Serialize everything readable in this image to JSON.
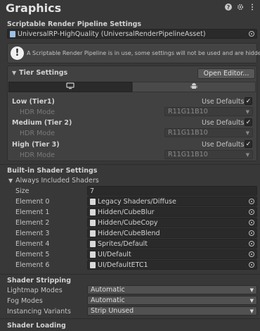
{
  "title": "Graphics",
  "header_icons": [
    "help-icon",
    "settings-icon",
    "more-icon"
  ],
  "srp": {
    "label": "Scriptable Render Pipeline Settings",
    "value": "UniversalRP-HighQuality (UniversalRenderPipelineAsset)",
    "info": "A Scriptable Render Pipeline is in use, some settings will not be used and are hidden"
  },
  "tier": {
    "foldout": "Tier Settings",
    "open_editor": "Open Editor...",
    "tabs": [
      "desktop-icon",
      "android-icon"
    ],
    "rows": [
      {
        "name": "Low (Tier1)",
        "use_defaults": "Use Defaults",
        "checked": true,
        "hdr_label": "HDR Mode",
        "hdr_value": "R11G11B10"
      },
      {
        "name": "Medium (Tier 2)",
        "use_defaults": "Use Defaults",
        "checked": true,
        "hdr_label": "HDR Mode",
        "hdr_value": "R11G11B10"
      },
      {
        "name": "High (Tier 3)",
        "use_defaults": "Use Defaults",
        "checked": true,
        "hdr_label": "HDR Mode",
        "hdr_value": "R11G11B10"
      }
    ]
  },
  "builtin": {
    "label": "Built-in Shader Settings",
    "foldout": "Always Included Shaders",
    "size_label": "Size",
    "size_value": "7",
    "elements": [
      {
        "label": "Element 0",
        "value": "Legacy Shaders/Diffuse"
      },
      {
        "label": "Element 1",
        "value": "Hidden/CubeBlur"
      },
      {
        "label": "Element 2",
        "value": "Hidden/CubeCopy"
      },
      {
        "label": "Element 3",
        "value": "Hidden/CubeBlend"
      },
      {
        "label": "Element 4",
        "value": "Sprites/Default"
      },
      {
        "label": "Element 5",
        "value": "UI/Default"
      },
      {
        "label": "Element 6",
        "value": "UI/DefaultETC1"
      }
    ]
  },
  "stripping": {
    "label": "Shader Stripping",
    "rows": [
      {
        "label": "Lightmap Modes",
        "value": "Automatic"
      },
      {
        "label": "Fog Modes",
        "value": "Automatic"
      },
      {
        "label": "Instancing Variants",
        "value": "Strip Unused"
      }
    ]
  },
  "loading": {
    "label": "Shader Loading"
  }
}
